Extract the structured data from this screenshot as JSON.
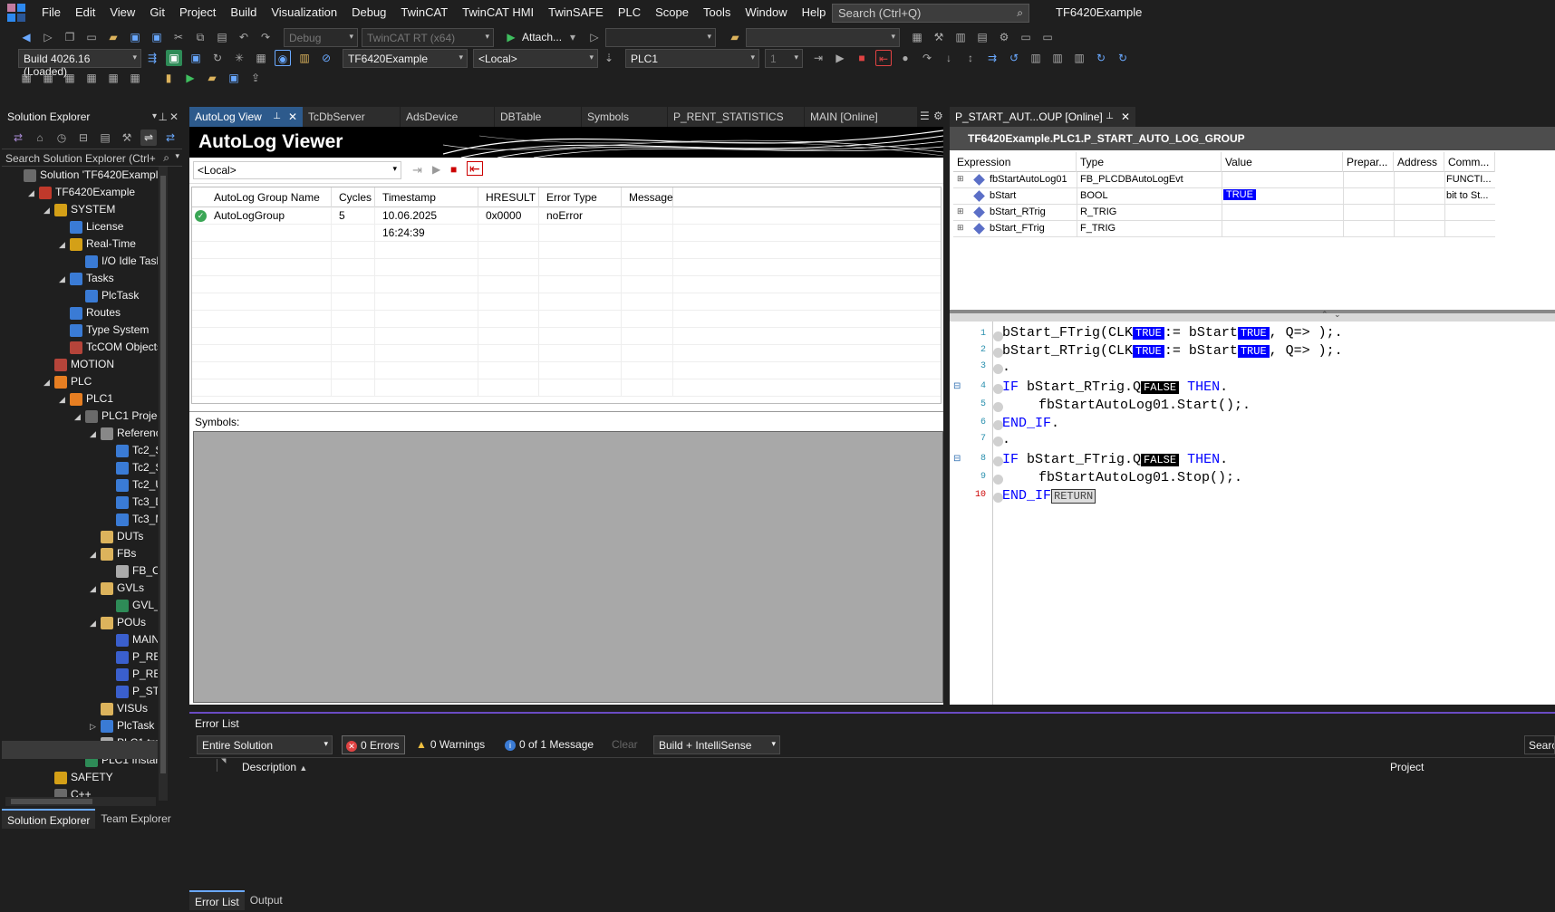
{
  "menu": [
    "File",
    "Edit",
    "View",
    "Git",
    "Project",
    "Build",
    "Visualization",
    "Debug",
    "TwinCAT",
    "TwinCAT HMI",
    "TwinSAFE",
    "PLC",
    "Scope",
    "Tools",
    "Window",
    "Help"
  ],
  "search_placeholder": "Search (Ctrl+Q)",
  "app_title": "TF6420Example",
  "toolbar": {
    "config": "Debug",
    "platform": "TwinCAT RT (x64)",
    "attach": "Attach...",
    "build_version": "Build 4026.16 (Loaded)",
    "project": "TF6420Example",
    "target": "<Local>",
    "plc": "PLC1",
    "plc_num": "1"
  },
  "solution_explorer": {
    "title": "Solution Explorer",
    "search": "Search Solution Explorer (Ctrl+",
    "items": [
      {
        "label": "Solution 'TF6420Example' (2",
        "indent": 0,
        "exp": "",
        "icon": "#6a6a6a"
      },
      {
        "label": "TF6420Example",
        "indent": 1,
        "exp": "◢",
        "icon": "#c0392b"
      },
      {
        "label": "SYSTEM",
        "indent": 2,
        "exp": "◢",
        "icon": "#d4a017"
      },
      {
        "label": "License",
        "indent": 3,
        "exp": "",
        "icon": "#3a7bd5"
      },
      {
        "label": "Real-Time",
        "indent": 3,
        "exp": "◢",
        "icon": "#d4a017"
      },
      {
        "label": "I/O Idle Task",
        "indent": 4,
        "exp": "",
        "icon": "#3a7bd5"
      },
      {
        "label": "Tasks",
        "indent": 3,
        "exp": "◢",
        "icon": "#3a7bd5"
      },
      {
        "label": "PlcTask",
        "indent": 4,
        "exp": "",
        "icon": "#3a7bd5"
      },
      {
        "label": "Routes",
        "indent": 3,
        "exp": "",
        "icon": "#3a7bd5"
      },
      {
        "label": "Type System",
        "indent": 3,
        "exp": "",
        "icon": "#3a7bd5"
      },
      {
        "label": "TcCOM Objects",
        "indent": 3,
        "exp": "",
        "icon": "#b5443a"
      },
      {
        "label": "MOTION",
        "indent": 2,
        "exp": "",
        "icon": "#b5443a"
      },
      {
        "label": "PLC",
        "indent": 2,
        "exp": "◢",
        "icon": "#e67e22"
      },
      {
        "label": "PLC1",
        "indent": 3,
        "exp": "◢",
        "icon": "#e67e22"
      },
      {
        "label": "PLC1 Project",
        "indent": 4,
        "exp": "◢",
        "icon": "#6a6a6a"
      },
      {
        "label": "References",
        "indent": 5,
        "exp": "◢",
        "icon": "#888"
      },
      {
        "label": "Tc2_Sta",
        "indent": 6,
        "exp": "",
        "icon": "#3a7bd5"
      },
      {
        "label": "Tc2_Sys",
        "indent": 6,
        "exp": "",
        "icon": "#3a7bd5"
      },
      {
        "label": "Tc2_Util",
        "indent": 6,
        "exp": "",
        "icon": "#3a7bd5"
      },
      {
        "label": "Tc3_Dat",
        "indent": 6,
        "exp": "",
        "icon": "#3a7bd5"
      },
      {
        "label": "Tc3_Mo",
        "indent": 6,
        "exp": "",
        "icon": "#3a7bd5"
      },
      {
        "label": "DUTs",
        "indent": 5,
        "exp": "",
        "icon": "#dcb35c"
      },
      {
        "label": "FBs",
        "indent": 5,
        "exp": "◢",
        "icon": "#dcb35c"
      },
      {
        "label": "FB_CLC",
        "indent": 6,
        "exp": "",
        "icon": "#aaa"
      },
      {
        "label": "GVLs",
        "indent": 5,
        "exp": "◢",
        "icon": "#dcb35c"
      },
      {
        "label": "GVL_Re",
        "indent": 6,
        "exp": "",
        "icon": "#2e8b57"
      },
      {
        "label": "POUs",
        "indent": 5,
        "exp": "◢",
        "icon": "#dcb35c"
      },
      {
        "label": "MAIN (",
        "indent": 6,
        "exp": "",
        "icon": "#3a5fcd"
      },
      {
        "label": "P_RENT",
        "indent": 6,
        "exp": "",
        "icon": "#3a5fcd"
      },
      {
        "label": "P_RENT",
        "indent": 6,
        "exp": "",
        "icon": "#3a5fcd"
      },
      {
        "label": "P_STAR",
        "indent": 6,
        "exp": "",
        "icon": "#3a5fcd"
      },
      {
        "label": "VISUs",
        "indent": 5,
        "exp": "",
        "icon": "#dcb35c"
      },
      {
        "label": "PlcTask (Pl",
        "indent": 5,
        "exp": "▷",
        "icon": "#3a7bd5"
      },
      {
        "label": "PLC1.tmc",
        "indent": 5,
        "exp": "",
        "icon": "#aaa"
      },
      {
        "label": "PLC1 Instance",
        "indent": 4,
        "exp": "",
        "icon": "#2e8b57"
      },
      {
        "label": "SAFETY",
        "indent": 2,
        "exp": "",
        "icon": "#d4a017"
      },
      {
        "label": "C++",
        "indent": 2,
        "exp": "",
        "icon": "#6a6a6a"
      },
      {
        "label": "VISION",
        "indent": 2,
        "exp": "",
        "icon": "#6a6a6a"
      },
      {
        "label": "ANALYTICS",
        "indent": 2,
        "exp": "",
        "icon": "#d4a017"
      },
      {
        "label": "I/O",
        "indent": 2,
        "exp": "◢",
        "icon": "#d4a017"
      },
      {
        "label": "Devices",
        "indent": 3,
        "exp": "",
        "icon": "#6a6a6a"
      }
    ],
    "bottom_tabs": [
      "Solution Explorer",
      "Team Explorer"
    ]
  },
  "doc_tabs": [
    "AutoLog View",
    "TcDbServer",
    "AdsDevice",
    "DBTable",
    "Symbols",
    "P_RENT_STATISTICS",
    "MAIN [Online]"
  ],
  "autolog": {
    "title": "AutoLog Viewer",
    "target": "<Local>",
    "columns": [
      "AutoLog Group Name",
      "Cycles",
      "Timestamp",
      "HRESULT",
      "Error Type",
      "Message"
    ],
    "rows": [
      [
        "AutoLogGroup",
        "5",
        "10.06.2025 16:24:39",
        "0x0000",
        "noError",
        ""
      ]
    ],
    "symbols_label": "Symbols:"
  },
  "online": {
    "tab": "P_START_AUT...OUP [Online]",
    "path": "TF6420Example.PLC1.P_START_AUTO_LOG_GROUP",
    "columns": [
      "Expression",
      "Type",
      "Value",
      "Prepar...",
      "Address",
      "Comm..."
    ],
    "rows": [
      {
        "exp": "⊞",
        "name": "fbStartAutoLog01",
        "type": "FB_PLCDBAutoLogEvt",
        "value": "",
        "comment": "FUNCTI..."
      },
      {
        "exp": "",
        "name": "bStart",
        "type": "BOOL",
        "value": "TRUE",
        "comment": "bit to St..."
      },
      {
        "exp": "⊞",
        "name": "bStart_RTrig",
        "type": "R_TRIG",
        "value": "",
        "comment": ""
      },
      {
        "exp": "⊞",
        "name": "bStart_FTrig",
        "type": "F_TRIG",
        "value": "",
        "comment": ""
      }
    ],
    "code": {
      "l1a": "bStart_FTrig(CLK",
      "v1a": "TRUE",
      "l1b": ":= bStart",
      "v1b": "TRUE",
      "l1c": ", Q=> );.",
      "l2a": "bStart_RTrig(CLK",
      "v2a": "TRUE",
      "l2b": ":= bStart",
      "v2b": "TRUE",
      "l2c": ", Q=> );.",
      "l3": ".",
      "if": "IF",
      "l4a": " bStart_RTrig.Q",
      "v4": "FALSE",
      "then": "THEN",
      "dot": ".",
      "l5": "fbStartAutoLog01.Start();.",
      "endif": "END_IF",
      "l7": ".",
      "l8a": " bStart_FTrig.Q",
      "v8": "FALSE",
      "l9": "fbStartAutoLog01.Stop();.",
      "ret": "RETURN"
    },
    "line_numbers": [
      "1",
      "2",
      "3",
      "4",
      "5",
      "6",
      "7",
      "8",
      "9",
      "10"
    ]
  },
  "error_list": {
    "title": "Error List",
    "scope": "Entire Solution",
    "errors": "0 Errors",
    "warnings": "0 Warnings",
    "messages": "0 of 1 Message",
    "clear": "Clear",
    "filter": "Build + IntelliSense",
    "search": "Searc",
    "col_desc": "Description",
    "col_project": "Project",
    "bottom_tabs": [
      "Error List",
      "Output"
    ]
  }
}
